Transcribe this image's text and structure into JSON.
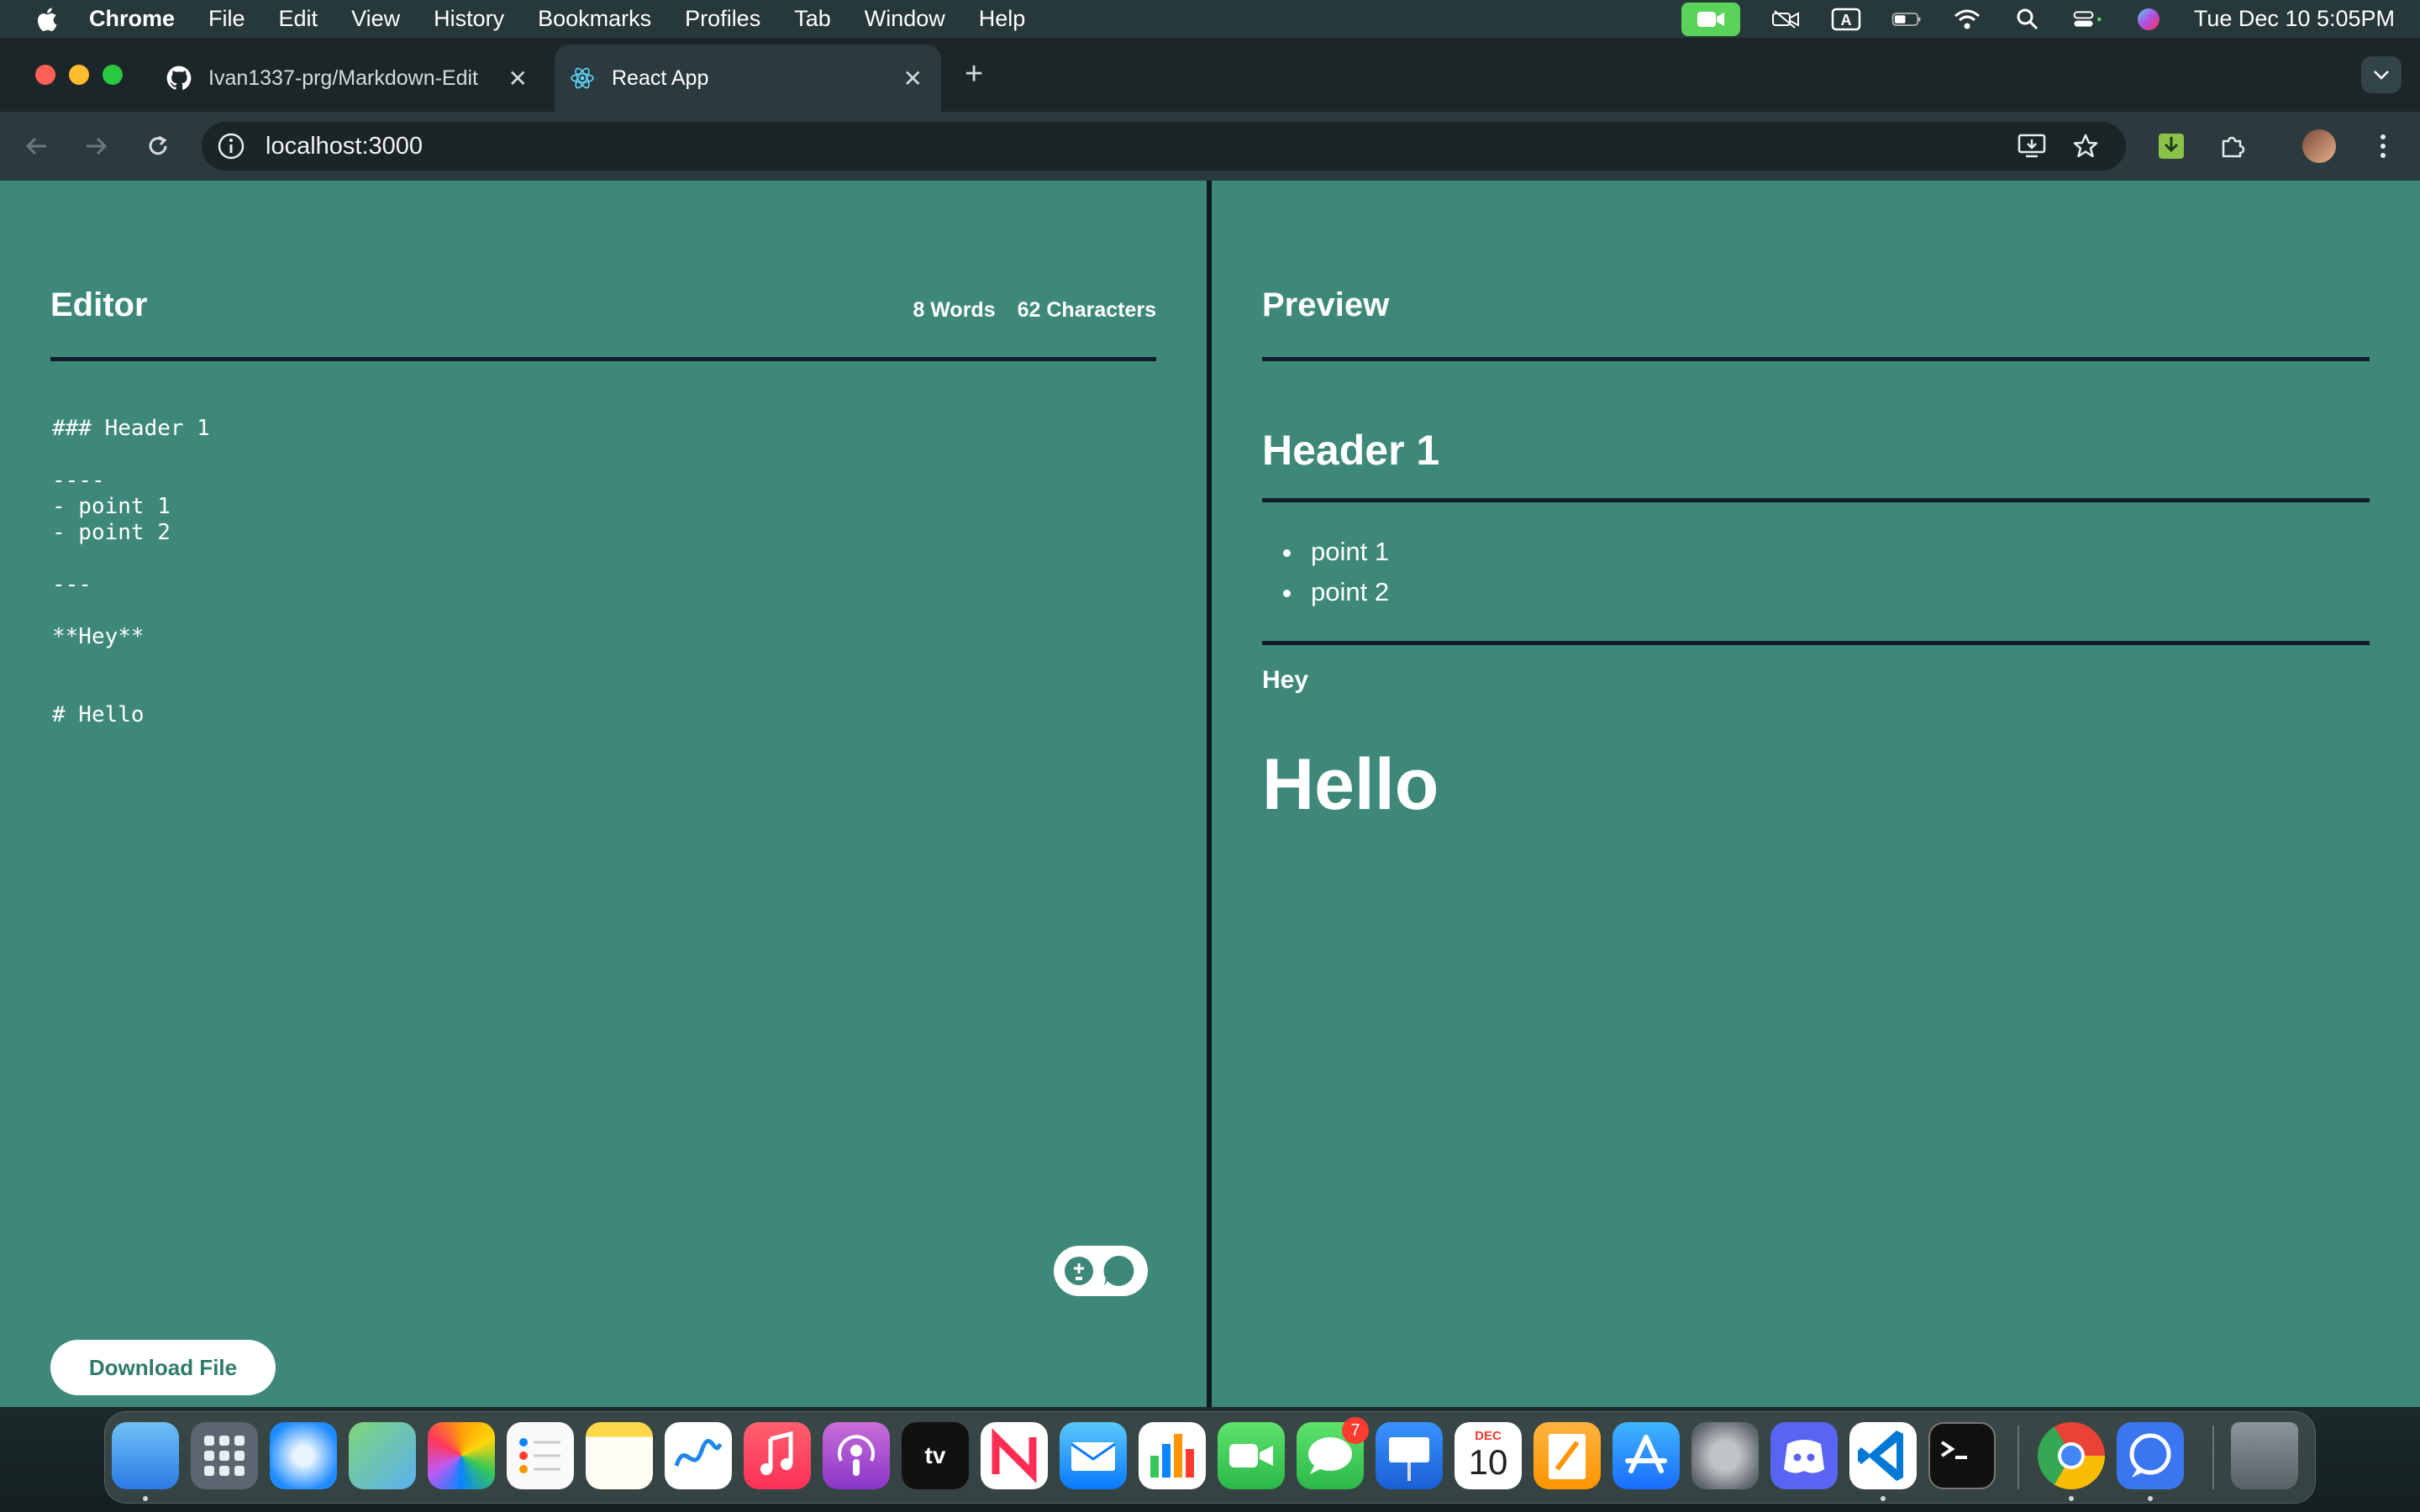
{
  "menubar": {
    "app": "Chrome",
    "items": [
      "File",
      "Edit",
      "View",
      "History",
      "Bookmarks",
      "Profiles",
      "Tab",
      "Window",
      "Help"
    ],
    "clock": "Tue Dec 10  5:05PM"
  },
  "tabs": [
    {
      "title": "Ivan1337-prg/Markdown-Edit",
      "icon": "github-icon"
    },
    {
      "title": "React App",
      "icon": "react-icon"
    }
  ],
  "address_bar": {
    "url": "localhost:3000"
  },
  "editor": {
    "title": "Editor",
    "word_count": "8 Words",
    "char_count": "62 Characters",
    "content": "### Header 1\n\n----\n- point 1\n- point 2\n\n---\n\n**Hey**\n\n\n# Hello",
    "download_label": "Download File"
  },
  "preview": {
    "title": "Preview",
    "h3": "Header 1",
    "list": [
      "point 1",
      "point 2"
    ],
    "bold": "Hey",
    "h1": "Hello"
  },
  "dock": {
    "apps": [
      "finder-icon",
      "launchpad-icon",
      "safari-icon",
      "maps-icon",
      "photos-icon",
      "reminders-icon",
      "notes-icon",
      "freeform-icon",
      "music-icon",
      "podcasts-icon",
      "tv-icon",
      "news-icon",
      "mail-icon",
      "numbers-icon",
      "facetime-icon",
      "messages-icon",
      "keynote-icon",
      "calendar-icon",
      "pages-icon",
      "app-store-icon",
      "system-settings-icon",
      "discord-icon",
      "vscode-icon",
      "terminal-icon",
      "chrome-icon",
      "signal-icon",
      "trash-icon"
    ],
    "messages_badge": "7",
    "calendar_month": "DEC",
    "calendar_day": "10",
    "tv_label": "tv"
  },
  "colors": {
    "page_bg": "#3d8878",
    "rule": "#131a2b",
    "button_text": "#2f7a6a"
  }
}
